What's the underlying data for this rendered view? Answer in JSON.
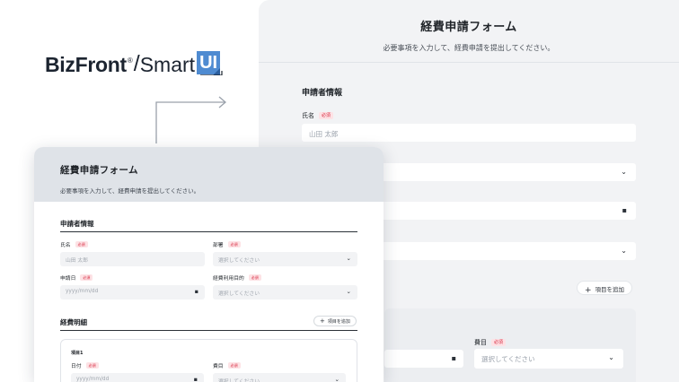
{
  "brand": {
    "name_bold": "BizFront",
    "registered": "®",
    "slash": "/",
    "name_light": "Smart",
    "ui": "UI",
    "logo_color": "#4f8bd1"
  },
  "form": {
    "title": "経費申請フォーム",
    "subtitle": "必要事項を入力して、経費申請を提出してください。",
    "applicant_section": "申請者情報",
    "details_section": "経費明細",
    "required_badge": "必須",
    "name_label": "氏名",
    "name_placeholder": "山田 太郎",
    "department_label": "部署",
    "select_placeholder": "選択してください",
    "date_label": "申請日",
    "date_placeholder": "yyyy/mm/dd",
    "purpose_label": "経費利用目的",
    "add_item_label": "項目を追加",
    "item_title": "項目1",
    "item_date_label": "日付",
    "item_expense_label": "費目"
  },
  "icons": {
    "chevron": "chevron-down-icon",
    "calendar": "calendar-icon",
    "plus": "plus-icon"
  },
  "colors": {
    "required_bg": "#fde2e5",
    "required_text": "#d7263d",
    "header_bg": "#dfe3e8"
  }
}
